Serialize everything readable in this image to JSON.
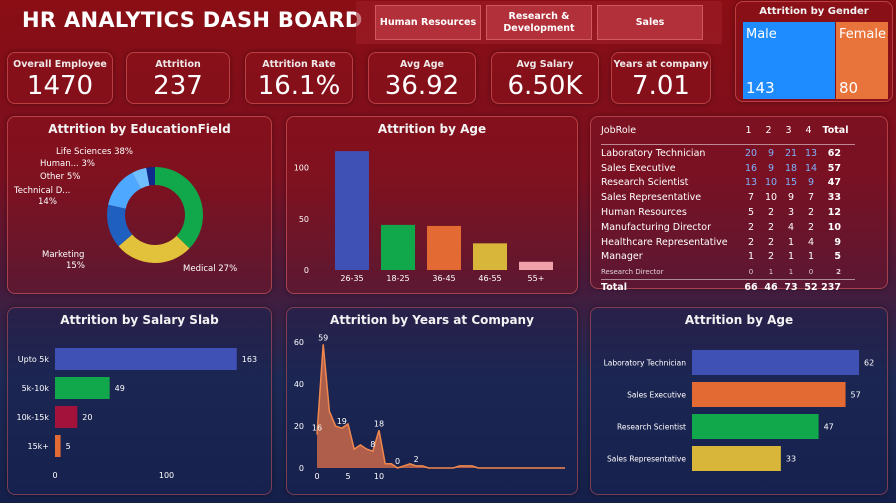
{
  "header": {
    "title": "HR ANALYTICS DASH BOARD"
  },
  "nav": [
    {
      "label": "Human Resources"
    },
    {
      "label": "Research &\nDevelopment"
    },
    {
      "label": "Sales"
    }
  ],
  "kpis": [
    {
      "label": "Overall Employee",
      "value": "1470"
    },
    {
      "label": "Attrition",
      "value": "237"
    },
    {
      "label": "Attrition Rate",
      "value": "16.1%"
    },
    {
      "label": "Avg Age",
      "value": "36.92"
    },
    {
      "label": "Avg Salary",
      "value": "6.50K"
    },
    {
      "label": "Years at company",
      "value": "7.01"
    }
  ],
  "gender": {
    "title": "Attrition by Gender",
    "male_label": "Male",
    "male_value": "143",
    "male_color": "#1e8cff",
    "female_label": "Female",
    "female_value": "80",
    "female_color": "#e8743b"
  },
  "colors": {
    "blue": "#3f51b5",
    "green": "#10a84a",
    "orange": "#e46a33",
    "yellow": "#d8b63a",
    "pink": "#f0a0a8",
    "crimson": "#a3123a",
    "area": "#e0734a"
  },
  "chart_data": [
    {
      "id": "education",
      "type": "pie",
      "title": "Attrition by EducationField",
      "slices": [
        {
          "label": "Life Sciences 38%",
          "value": 38,
          "color": "#10a84a"
        },
        {
          "label": "Medical 27%",
          "value": 27,
          "color": "#e2c23a"
        },
        {
          "label": "Marketing\n15%",
          "value": 15,
          "color": "#1e5fbf"
        },
        {
          "label": "Technical D...\n14%",
          "value": 14,
          "color": "#4fa8ff"
        },
        {
          "label": "Other 5%",
          "value": 5,
          "color": "#6fbfff"
        },
        {
          "label": "Human... 3%",
          "value": 3,
          "color": "#0d2a8c"
        }
      ]
    },
    {
      "id": "age",
      "type": "bar",
      "title": "Attrition by Age",
      "categories": [
        "26-35",
        "18-25",
        "36-45",
        "46-55",
        "55+"
      ],
      "values": [
        116,
        44,
        43,
        26,
        8
      ],
      "colors": [
        "#3f51b5",
        "#10a84a",
        "#e46a33",
        "#d8b63a",
        "#f0a0a8"
      ],
      "yticks": [
        0,
        50,
        100
      ],
      "ylim": [
        0,
        120
      ]
    },
    {
      "id": "salary",
      "type": "bar",
      "orientation": "horizontal",
      "title": "Attrition by Salary Slab",
      "categories": [
        "Upto 5k",
        "5k-10k",
        "10k-15k",
        "15k+"
      ],
      "values": [
        163,
        49,
        20,
        5
      ],
      "colors": [
        "#3f51b5",
        "#10a84a",
        "#a3123a",
        "#e46a33"
      ],
      "xticks": [
        0,
        100
      ],
      "xlim": [
        0,
        165
      ]
    },
    {
      "id": "years",
      "type": "area",
      "title": "Attrition by Years at Company",
      "x": [
        0,
        1,
        2,
        3,
        4,
        5,
        6,
        7,
        8,
        9,
        10,
        11,
        12,
        13,
        14,
        15,
        16,
        17,
        18,
        19,
        20,
        21,
        22,
        23,
        24,
        25,
        26,
        27,
        28,
        29,
        30,
        31,
        32,
        33,
        34,
        35,
        36,
        37,
        38,
        39,
        40
      ],
      "y": [
        16,
        59,
        27,
        20,
        19,
        21,
        9,
        11,
        9,
        8,
        18,
        2,
        2,
        0,
        1,
        2,
        1,
        1,
        0,
        0,
        0,
        0,
        0,
        1,
        1,
        1,
        0,
        0,
        0,
        0,
        0,
        0,
        0,
        0,
        0,
        0,
        0,
        0,
        0,
        0,
        0
      ],
      "labels": {
        "0": "16",
        "1": "59",
        "4": "19",
        "9": "8",
        "10": "18",
        "13": "0",
        "16": "2"
      },
      "xticks": [
        0,
        5,
        10
      ],
      "yticks": [
        0,
        20,
        40,
        60
      ],
      "ylim": [
        0,
        62
      ]
    },
    {
      "id": "jobrole_bar",
      "type": "bar",
      "orientation": "horizontal",
      "title": "Attrition by Age",
      "categories": [
        "Laboratory Technician",
        "Sales Executive",
        "Research Scientist",
        "Sales Representative"
      ],
      "values": [
        62,
        57,
        47,
        33
      ],
      "colors": [
        "#3f51b5",
        "#e46a33",
        "#10a84a",
        "#d8b63a"
      ],
      "xlim": [
        0,
        62
      ]
    },
    {
      "id": "jobrole_table",
      "type": "table",
      "headers": [
        "JobRole",
        "1",
        "2",
        "3",
        "4",
        "Total"
      ],
      "rows": [
        [
          "Laboratory Technician",
          "20",
          "9",
          "21",
          "13",
          "62"
        ],
        [
          "Sales Executive",
          "16",
          "9",
          "18",
          "14",
          "57"
        ],
        [
          "Research Scientist",
          "13",
          "10",
          "15",
          "9",
          "47"
        ],
        [
          "Sales Representative",
          "7",
          "10",
          "9",
          "7",
          "33"
        ],
        [
          "Human Resources",
          "5",
          "2",
          "3",
          "2",
          "12"
        ],
        [
          "Manufacturing Director",
          "2",
          "2",
          "4",
          "2",
          "10"
        ],
        [
          "Healthcare Representative",
          "2",
          "2",
          "1",
          "4",
          "9"
        ],
        [
          "Manager",
          "1",
          "2",
          "1",
          "1",
          "5"
        ],
        [
          "Research Director",
          "0",
          "1",
          "1",
          "0",
          "2"
        ]
      ],
      "total": [
        "Total",
        "66",
        "46",
        "73",
        "52",
        "237"
      ]
    }
  ]
}
